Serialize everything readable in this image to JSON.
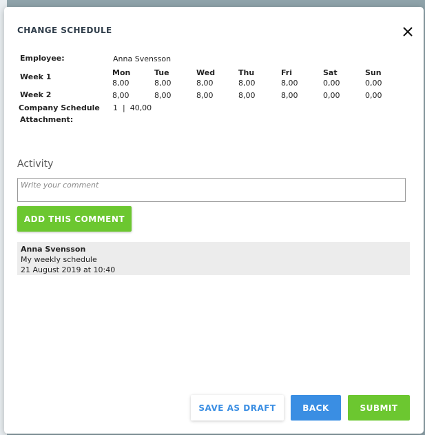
{
  "dialog": {
    "title": "CHANGE SCHEDULE"
  },
  "schedule": {
    "employee_label": "Employee:",
    "employee_name": "Anna Svensson",
    "days": [
      "Mon",
      "Tue",
      "Wed",
      "Thu",
      "Fri",
      "Sat",
      "Sun"
    ],
    "weeks": [
      {
        "label": "Week 1",
        "hours": [
          "8,00",
          "8,00",
          "8,00",
          "8,00",
          "8,00",
          "0,00",
          "0,00"
        ]
      },
      {
        "label": "Week 2",
        "hours": [
          "8,00",
          "8,00",
          "8,00",
          "8,00",
          "8,00",
          "0,00",
          "0,00"
        ]
      }
    ],
    "company_schedule_label": "Company Schedule",
    "company_schedule_value": "1  |  40,00",
    "attachment_label": "Attachment:"
  },
  "activity": {
    "title": "Activity",
    "comment_placeholder": "Write your comment",
    "add_comment_label": "ADD THIS COMMENT",
    "items": [
      {
        "author": "Anna Svensson",
        "text": "My weekly schedule",
        "date": "21 August 2019 at 10:40"
      }
    ]
  },
  "footer": {
    "save_draft_label": "SAVE AS DRAFT",
    "back_label": "BACK",
    "submit_label": "SUBMIT"
  },
  "colors": {
    "green": "#6cc730",
    "blue": "#3a8ee3",
    "backdrop": "#8fa3aa"
  }
}
